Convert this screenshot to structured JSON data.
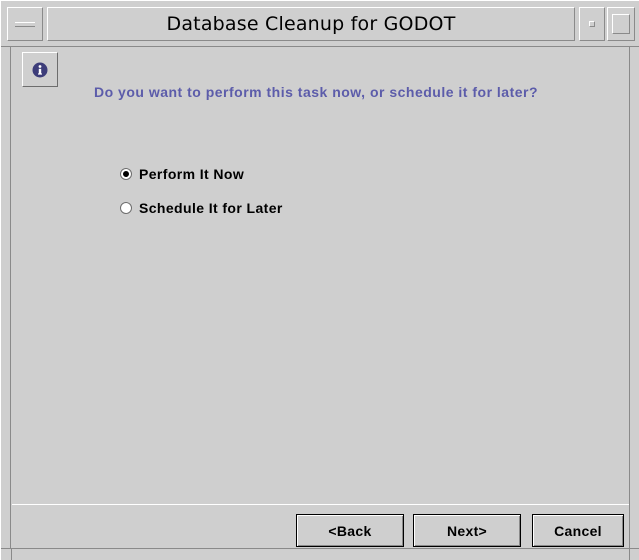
{
  "window": {
    "title": "Database Cleanup for GODOT"
  },
  "dialog": {
    "icon": "info-icon",
    "question": "Do you want to perform this task now, or schedule it for later?",
    "options": [
      {
        "label": "Perform It Now",
        "selected": true
      },
      {
        "label": "Schedule It for Later",
        "selected": false
      }
    ]
  },
  "buttons": {
    "back": "<Back",
    "next": "Next>",
    "cancel": "Cancel"
  },
  "colors": {
    "background": "#cfcfcf",
    "question_text": "#5c5caa",
    "info_icon": "#3d3d7a"
  }
}
